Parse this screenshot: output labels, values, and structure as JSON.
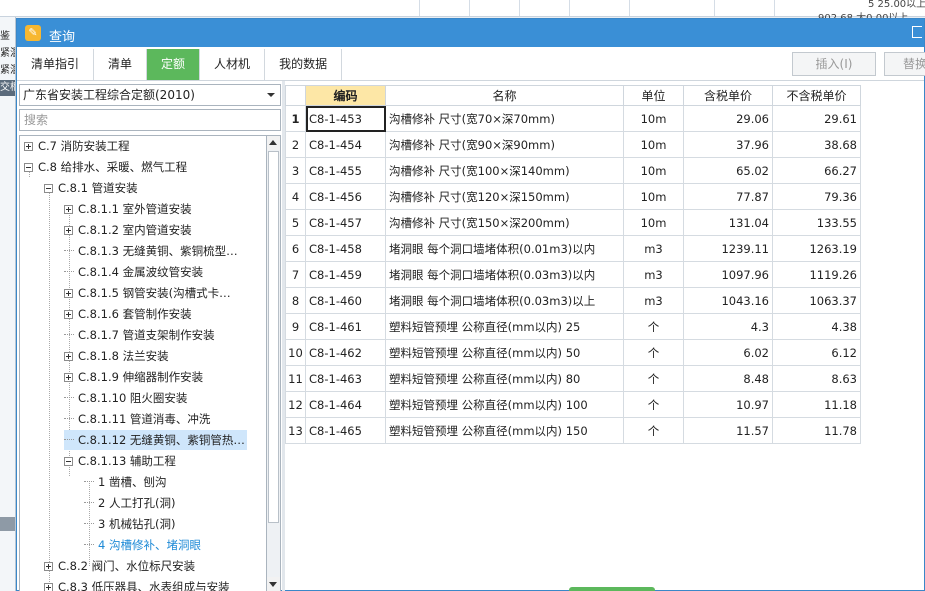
{
  "background_app": {
    "top_values": [
      "5 25.00以上",
      "902.68 大0.00以上"
    ],
    "left_fragments": [
      "鉴",
      "紧混",
      "紧混",
      "交槽"
    ]
  },
  "dialog": {
    "title": "查询",
    "tabs": [
      {
        "label": "清单指引",
        "active": false
      },
      {
        "label": "清单",
        "active": false
      },
      {
        "label": "定额",
        "active": true
      },
      {
        "label": "人材机",
        "active": false
      },
      {
        "label": "我的数据",
        "active": false
      }
    ],
    "buttons": {
      "insert": "插入(I)",
      "replace": "替换"
    }
  },
  "left_panel": {
    "quota_library": "广东省安装工程综合定额(2010)",
    "search_placeholder": "搜索",
    "tree": [
      {
        "label": "C.7 消防安装工程",
        "toggle": "plus"
      },
      {
        "label": "C.8 给排水、采暖、燃气工程",
        "toggle": "minus"
      },
      {
        "label": "C.8.1 管道安装",
        "toggle": "minus"
      },
      {
        "label": "C.8.1.1 室外管道安装",
        "toggle": "plus"
      },
      {
        "label": "C.8.1.2 室内管道安装",
        "toggle": "plus"
      },
      {
        "label": "C.8.1.3 无缝黄铜、紫铜梳型…",
        "toggle": "none"
      },
      {
        "label": "C.8.1.4 金属波纹管安装",
        "toggle": "none"
      },
      {
        "label": "C.8.1.5 钢管安装(沟槽式卡…",
        "toggle": "plus"
      },
      {
        "label": "C.8.1.6 套管制作安装",
        "toggle": "plus"
      },
      {
        "label": "C.8.1.7 管道支架制作安装",
        "toggle": "none"
      },
      {
        "label": "C.8.1.8 法兰安装",
        "toggle": "plus"
      },
      {
        "label": "C.8.1.9 伸缩器制作安装",
        "toggle": "plus"
      },
      {
        "label": "C.8.1.10 阻火圈安装",
        "toggle": "none"
      },
      {
        "label": "C.8.1.11 管道消毒、冲洗",
        "toggle": "none"
      },
      {
        "label": "C.8.1.12 无缝黄铜、紫铜管热…",
        "toggle": "none",
        "selected": true
      },
      {
        "label": "C.8.1.13 辅助工程",
        "toggle": "minus"
      },
      {
        "label": "1 凿槽、刨沟",
        "toggle": "none"
      },
      {
        "label": "2 人工打孔(洞)",
        "toggle": "none"
      },
      {
        "label": "3 机械钻孔(洞)",
        "toggle": "none"
      },
      {
        "label": "4 沟槽修补、堵洞眼",
        "toggle": "none",
        "link": true
      },
      {
        "label": "C.8.2 阀门、水位标尺安装",
        "toggle": "plus"
      },
      {
        "label": "C.8.3 低压器具、水表组成与安装",
        "toggle": "plus"
      }
    ]
  },
  "table": {
    "headers": [
      "编码",
      "名称",
      "单位",
      "含税单价",
      "不含税单价"
    ],
    "rows": [
      {
        "idx": "1",
        "code": "C8-1-453",
        "name": "沟槽修补 尺寸(宽70×深70mm)",
        "unit": "10m",
        "price_tax": "29.06",
        "price_notax": "29.61"
      },
      {
        "idx": "2",
        "code": "C8-1-454",
        "name": "沟槽修补 尺寸(宽90×深90mm)",
        "unit": "10m",
        "price_tax": "37.96",
        "price_notax": "38.68"
      },
      {
        "idx": "3",
        "code": "C8-1-455",
        "name": "沟槽修补 尺寸(宽100×深140mm)",
        "unit": "10m",
        "price_tax": "65.02",
        "price_notax": "66.27"
      },
      {
        "idx": "4",
        "code": "C8-1-456",
        "name": "沟槽修补 尺寸(宽120×深150mm)",
        "unit": "10m",
        "price_tax": "77.87",
        "price_notax": "79.36"
      },
      {
        "idx": "5",
        "code": "C8-1-457",
        "name": "沟槽修补 尺寸(宽150×深200mm)",
        "unit": "10m",
        "price_tax": "131.04",
        "price_notax": "133.55"
      },
      {
        "idx": "6",
        "code": "C8-1-458",
        "name": "堵洞眼 每个洞口墙堵体积(0.01m3)以内",
        "unit": "m3",
        "price_tax": "1239.11",
        "price_notax": "1263.19"
      },
      {
        "idx": "7",
        "code": "C8-1-459",
        "name": "堵洞眼 每个洞口墙堵体积(0.03m3)以内",
        "unit": "m3",
        "price_tax": "1097.96",
        "price_notax": "1119.26"
      },
      {
        "idx": "8",
        "code": "C8-1-460",
        "name": "堵洞眼 每个洞口墙堵体积(0.03m3)以上",
        "unit": "m3",
        "price_tax": "1043.16",
        "price_notax": "1063.37"
      },
      {
        "idx": "9",
        "code": "C8-1-461",
        "name": "塑料短管预埋 公称直径(mm以内) 25",
        "unit": "个",
        "price_tax": "4.3",
        "price_notax": "4.38"
      },
      {
        "idx": "10",
        "code": "C8-1-462",
        "name": "塑料短管预埋 公称直径(mm以内) 50",
        "unit": "个",
        "price_tax": "6.02",
        "price_notax": "6.12"
      },
      {
        "idx": "11",
        "code": "C8-1-463",
        "name": "塑料短管预埋 公称直径(mm以内) 80",
        "unit": "个",
        "price_tax": "8.48",
        "price_notax": "8.63"
      },
      {
        "idx": "12",
        "code": "C8-1-464",
        "name": "塑料短管预埋 公称直径(mm以内) 100",
        "unit": "个",
        "price_tax": "10.97",
        "price_notax": "11.18"
      },
      {
        "idx": "13",
        "code": "C8-1-465",
        "name": "塑料短管预埋 公称直径(mm以内) 150",
        "unit": "个",
        "price_tax": "11.57",
        "price_notax": "11.78"
      }
    ]
  }
}
